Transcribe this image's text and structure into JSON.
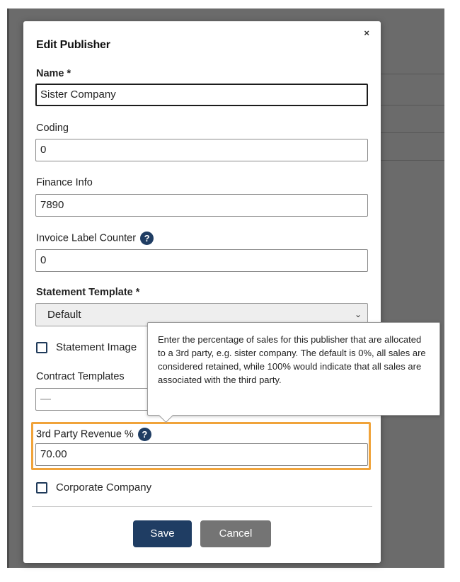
{
  "modal": {
    "title": "Edit Publisher",
    "close_glyph": "×"
  },
  "fields": {
    "name": {
      "label": "Name *",
      "value": "Sister Company"
    },
    "coding": {
      "label": "Coding",
      "value": "0"
    },
    "finance_info": {
      "label": "Finance Info",
      "value": "7890"
    },
    "invoice_label_counter": {
      "label": "Invoice Label Counter",
      "value": "0",
      "help_icon": "question-circle-icon"
    },
    "statement_template": {
      "label": "Statement Template *",
      "selected": "Default"
    },
    "statement_image": {
      "label": "Statement Image"
    },
    "contract_templates": {
      "label": "Contract Templates",
      "selected": "—"
    },
    "third_party_revenue": {
      "label": "3rd Party Revenue %",
      "value": "70.00",
      "help_icon": "question-circle-icon"
    },
    "corporate_company": {
      "label": "Corporate Company"
    }
  },
  "tooltip": {
    "text": "Enter the percentage of sales for this publisher that are allocated to a 3rd party, e.g. sister company. The default is 0%, all sales are considered retained, while 100% would indicate that all sales are associated with the third party."
  },
  "buttons": {
    "save": "Save",
    "cancel": "Cancel"
  },
  "colors": {
    "primary": "#1f3d63",
    "secondary_button": "#747474",
    "highlight": "#f0a33a"
  }
}
